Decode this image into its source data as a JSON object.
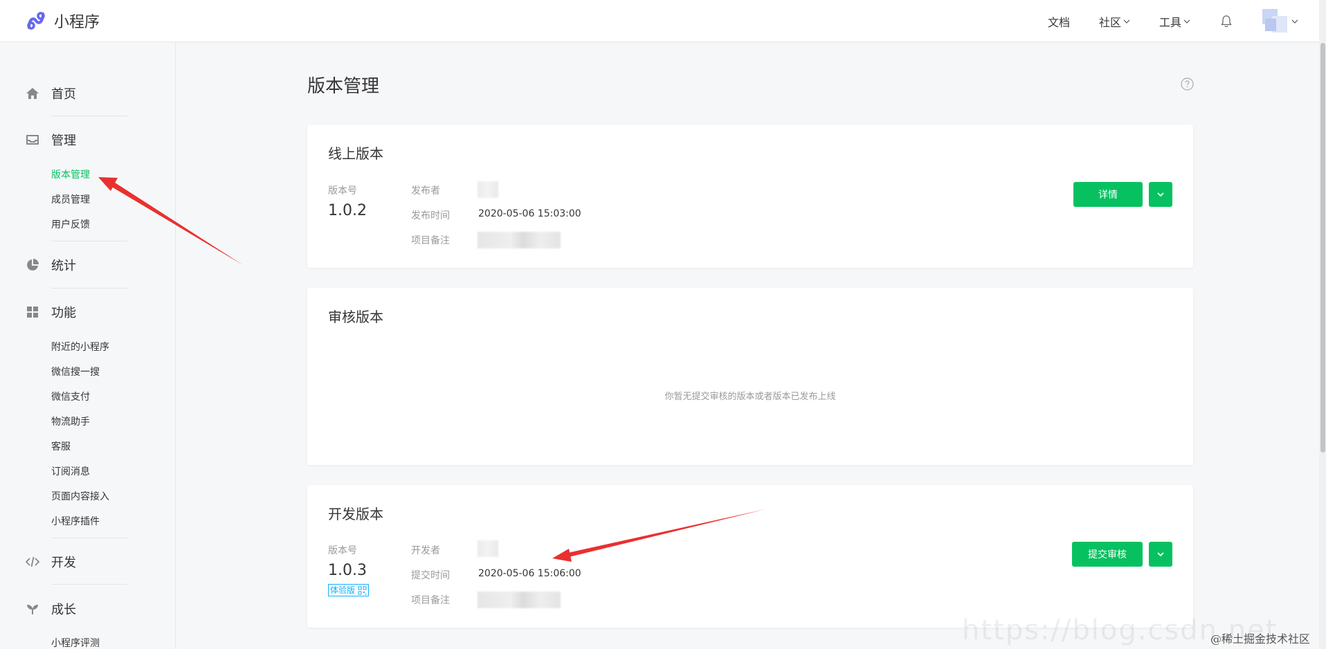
{
  "header": {
    "logo_text": "小程序",
    "nav": [
      {
        "label": "文档",
        "has_dropdown": false
      },
      {
        "label": "社区",
        "has_dropdown": true
      },
      {
        "label": "工具",
        "has_dropdown": true
      }
    ],
    "icons": [
      "bell-icon",
      "avatar",
      "chevron-down-icon"
    ]
  },
  "sidebar": {
    "sections": [
      {
        "label": "首页",
        "icon": "home-icon"
      },
      {
        "label": "管理",
        "icon": "inbox-icon",
        "items": [
          "版本管理",
          "成员管理",
          "用户反馈"
        ],
        "active": "版本管理"
      },
      {
        "label": "统计",
        "icon": "pie-chart-icon"
      },
      {
        "label": "功能",
        "icon": "grid-icon",
        "items": [
          "附近的小程序",
          "微信搜一搜",
          "微信支付",
          "物流助手",
          "客服",
          "订阅消息",
          "页面内容接入",
          "小程序插件"
        ]
      },
      {
        "label": "开发",
        "icon": "code-icon"
      },
      {
        "label": "成长",
        "icon": "sprout-icon",
        "items": [
          "小程序评测"
        ]
      }
    ]
  },
  "main": {
    "title": "版本管理",
    "online": {
      "title": "线上版本",
      "version_label": "版本号",
      "version": "1.0.2",
      "fields": [
        {
          "key": "发布者",
          "value": ""
        },
        {
          "key": "发布时间",
          "value": "2020-05-06 15:03:00"
        },
        {
          "key": "项目备注",
          "value": ""
        }
      ],
      "button": "详情"
    },
    "review": {
      "title": "审核版本",
      "empty_text": "你暂无提交审核的版本或者版本已发布上线"
    },
    "dev": {
      "title": "开发版本",
      "version_label": "版本号",
      "version": "1.0.3",
      "badge": "体验版",
      "fields": [
        {
          "key": "开发者",
          "value": ""
        },
        {
          "key": "提交时间",
          "value": "2020-05-06 15:06:00"
        },
        {
          "key": "项目备注",
          "value": ""
        }
      ],
      "button": "提交审核"
    }
  },
  "watermark": {
    "text": "@稀土掘金技术社区"
  },
  "colors": {
    "primary_green": "#07c160",
    "badge_blue": "#10aeff",
    "arrow_red": "#e8312f"
  }
}
